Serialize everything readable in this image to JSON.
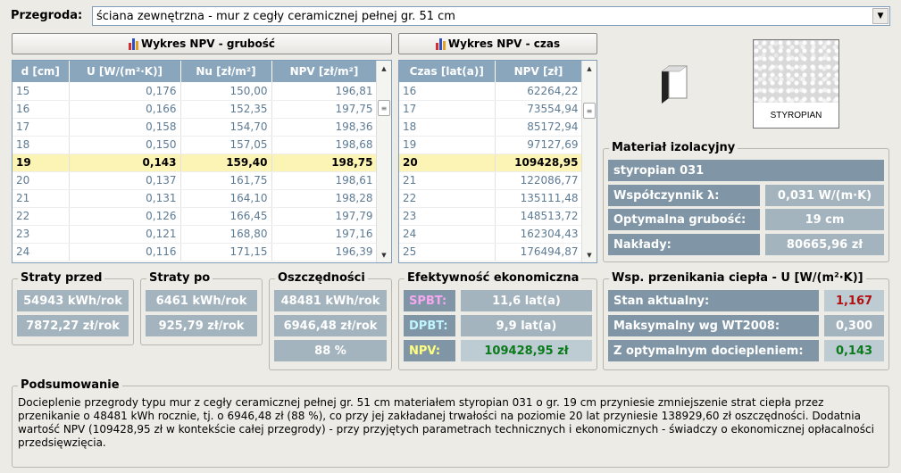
{
  "partition": {
    "label": "Przegroda:",
    "selected": "ściana zewnętrzna - mur z cegły ceramicznej pełnej gr. 51 cm"
  },
  "buttons": {
    "npv_thickness": "Wykres NPV - grubość",
    "npv_time": "Wykres NPV - czas"
  },
  "thickness_table": {
    "headers": [
      "d [cm]",
      "U [W/(m²·K)]",
      "Nu [zł/m²]",
      "NPV [zł/m²]"
    ],
    "rows": [
      [
        "15",
        "0,176",
        "150,00",
        "196,81"
      ],
      [
        "16",
        "0,166",
        "152,35",
        "197,75"
      ],
      [
        "17",
        "0,158",
        "154,70",
        "198,36"
      ],
      [
        "18",
        "0,150",
        "157,05",
        "198,68"
      ],
      [
        "19",
        "0,143",
        "159,40",
        "198,75"
      ],
      [
        "20",
        "0,137",
        "161,75",
        "198,61"
      ],
      [
        "21",
        "0,131",
        "164,10",
        "198,28"
      ],
      [
        "22",
        "0,126",
        "166,45",
        "197,79"
      ],
      [
        "23",
        "0,121",
        "168,80",
        "197,16"
      ],
      [
        "24",
        "0,116",
        "171,15",
        "196,39"
      ]
    ],
    "selected_index": 4
  },
  "time_table": {
    "headers": [
      "Czas [lat(a)]",
      "NPV [zł]"
    ],
    "rows": [
      [
        "16",
        "62264,22"
      ],
      [
        "17",
        "73554,94"
      ],
      [
        "18",
        "85172,94"
      ],
      [
        "19",
        "97127,69"
      ],
      [
        "20",
        "109428,95"
      ],
      [
        "21",
        "122086,77"
      ],
      [
        "22",
        "135111,48"
      ],
      [
        "23",
        "148513,72"
      ],
      [
        "24",
        "162304,43"
      ],
      [
        "25",
        "176494,87"
      ]
    ],
    "selected_index": 4
  },
  "material_image": {
    "caption": "STYROPIAN"
  },
  "insulation": {
    "title": "Materiał izolacyjny",
    "name": "styropian 031",
    "lambda_label": "Współczynnik λ:",
    "lambda_value": "0,031 W/(m·K)",
    "opt_label": "Optymalna grubość:",
    "opt_value": "19 cm",
    "cost_label": "Nakłady:",
    "cost_value": "80665,96 zł"
  },
  "losses_before": {
    "title": "Straty przed",
    "kwh": "54943 kWh/rok",
    "pln": "7872,27 zł/rok"
  },
  "losses_after": {
    "title": "Straty po",
    "kwh": "6461 kWh/rok",
    "pln": "925,79 zł/rok"
  },
  "savings": {
    "title": "Oszczędności",
    "kwh": "48481 kWh/rok",
    "pln": "6946,48 zł/rok",
    "pct": "88 %"
  },
  "efficiency": {
    "title": "Efektywność ekonomiczna",
    "spbt_label": "SPBT:",
    "spbt_value": "11,6 lat(a)",
    "dpbt_label": "DPBT:",
    "dpbt_value": "9,9 lat(a)",
    "npv_label": "NPV:",
    "npv_value": "109428,95 zł",
    "colors": {
      "spbt": "#f5a8f0",
      "dpbt": "#c0f4ff",
      "npv": "#ffff80",
      "npv_value": "#0a7a1a"
    }
  },
  "heat_coef": {
    "title": "Wsp. przenikania ciepła  -  U [W/(m²·K)]",
    "current_label": "Stan aktualny:",
    "current_value": "1,167",
    "max_label": "Maksymalny wg WT2008:",
    "max_value": "0,300",
    "opt_label": "Z optymalnym dociepleniem:",
    "opt_value": "0,143",
    "colors": {
      "current": "#b01010",
      "max": "#ffffff",
      "opt": "#0a7a1a"
    }
  },
  "summary": {
    "title": "Podsumowanie",
    "text": "Docieplenie przegrody typu mur z cegły ceramicznej pełnej gr. 51 cm materiałem styropian 031 o gr. 19 cm przyniesie zmniejszenie strat ciepła przez przenikanie o 48481 kWh rocznie, tj. o 6946,48 zł (88 %), co przy jej zakładanej trwałości na poziomie 20 lat przyniesie 138929,60 zł oszczędności. Dodatnia wartość NPV (109428,95 zł w kontekście całej przegrody) - przy przyjętych parametrach technicznych i ekonomicznych - świadczy o ekonomicznej opłacalności przedsięwzięcia."
  }
}
